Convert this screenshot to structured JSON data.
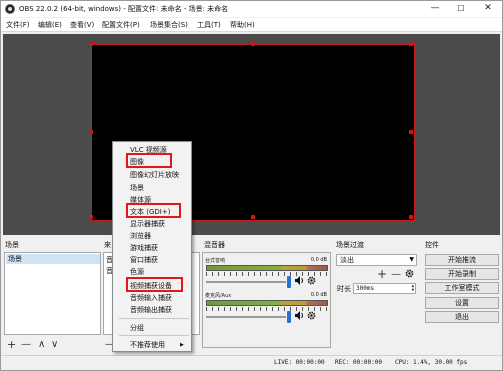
{
  "window": {
    "title": "OBS 22.0.2 (64-bit, windows) - 配置文件: 未命名 - 场景: 未命名",
    "minimize": "—",
    "maximize": "☐",
    "close": "✕"
  },
  "menubar": {
    "items": [
      "文件(F)",
      "编辑(E)",
      "查看(V)",
      "配置文件(P)",
      "场景集合(S)",
      "工具(T)",
      "帮助(H)"
    ]
  },
  "docks": {
    "scenes": {
      "title": "场景",
      "items": [
        "场景"
      ],
      "add": "+",
      "remove": "—",
      "up": "∧",
      "down": "∨"
    },
    "sources": {
      "title": "来",
      "partial_rows": [
        "音",
        "音"
      ],
      "partial_button": "—"
    },
    "mixer": {
      "title": "混音器",
      "channels": [
        {
          "name": "台式音响",
          "db": "0.0 dB"
        },
        {
          "name": "麦克风/Aux",
          "db": "0.0 dB"
        }
      ]
    },
    "transitions": {
      "title": "场景过渡",
      "selected": "淡出",
      "add": "+",
      "remove": "—",
      "duration_label": "时长",
      "duration_value": "300ms"
    },
    "controls": {
      "title": "控件",
      "buttons": [
        "开始推流",
        "开始录制",
        "工作室模式",
        "设置",
        "退出"
      ]
    }
  },
  "status": {
    "live": "LIVE: 00:00:00",
    "rec": "REC: 00:00:00",
    "cpu": "CPU: 1.4%, 30.00 fps"
  },
  "context_menu": {
    "items": [
      "VLC 视频源",
      "图像",
      "图像幻灯片放映",
      "场景",
      "媒体源",
      "文本 (GDI+)",
      "显示器捕获",
      "浏览器",
      "游戏捕获",
      "窗口捕获",
      "色源",
      "视频捕获设备",
      "音频输入捕获",
      "音频输出捕获",
      "分组",
      "不推荐使用"
    ],
    "submenu_arrow": "▶"
  },
  "colors": {
    "highlight": "#e0181e",
    "selection_border": "#c81818",
    "preview_bg": "#4b4b4b"
  }
}
